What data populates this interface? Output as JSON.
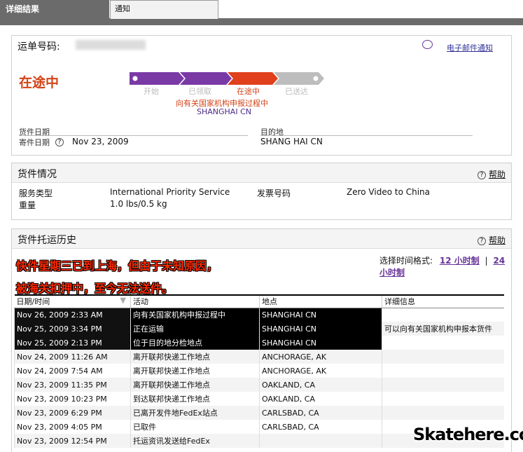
{
  "tabs": {
    "active": "详细结果",
    "inactive": "通知"
  },
  "shipment": {
    "tracking_label": "运单号码:",
    "email_label": "电子邮件通知",
    "status": "在途中",
    "progress": {
      "steps": [
        "开始",
        "已领取",
        "在途中",
        "已送达"
      ],
      "current_index": 2,
      "message": "向有关国家机构申报过程中",
      "location": "SHANGHAI CN",
      "colors": {
        "done": "#7a3aa6",
        "current": "#e0401c",
        "pending": "#bdbdbd"
      }
    },
    "ship_date_group_label": "货件日期",
    "ship_date_label": "寄件日期",
    "ship_date": "Nov 23, 2009",
    "destination_label": "目的地",
    "destination": "SHANG HAI CN"
  },
  "details": {
    "title": "货件情况",
    "help": "帮助",
    "service_type_label": "服务类型",
    "service_type": "International Priority Service",
    "invoice_label": "发票号码",
    "invoice": "Zero Video to China",
    "weight_label": "重量",
    "weight": "1.0 lbs/0.5 kg"
  },
  "history": {
    "title": "货件托运历史",
    "help": "帮助",
    "alert_line1": "快件星期三已到上海，但由于未知原因，",
    "alert_line2": "被海关扣押中，至今无法送件。",
    "time_format_label": "选择时间格式:",
    "format_12": "12 小时制",
    "separator": "|",
    "format_24": "24 小时制",
    "columns": [
      "日期/时间",
      "活动",
      "地点",
      "详细信息"
    ],
    "rows": [
      [
        "Nov 26, 2009 2:33 AM",
        "向有关国家机构申报过程中",
        "SHANGHAI CN",
        ""
      ],
      [
        "Nov 25, 2009 3:34 PM",
        "正在运输",
        "SHANGHAI CN",
        "可以向有关国家机构申报本货件"
      ],
      [
        "Nov 25, 2009 2:13 PM",
        "位于目的地分检地点",
        "SHANGHAI CN",
        ""
      ],
      [
        "Nov 24, 2009 11:26 AM",
        "离开联邦快递工作地点",
        "ANCHORAGE, AK",
        ""
      ],
      [
        "Nov 24, 2009 7:54 AM",
        "离开联邦快递工作地点",
        "ANCHORAGE, AK",
        ""
      ],
      [
        "Nov 23, 2009 11:35 PM",
        "离开联邦快递工作地点",
        "OAKLAND, CA",
        ""
      ],
      [
        "Nov 23, 2009 10:23 PM",
        "到达联邦快递工作地点",
        "OAKLAND, CA",
        ""
      ],
      [
        "Nov 23, 2009 6:29 PM",
        "已离开发件地FedEx站点",
        "CARLSBAD, CA",
        ""
      ],
      [
        "Nov 23, 2009 4:05 PM",
        "已取件",
        "CARLSBAD, CA",
        ""
      ],
      [
        "Nov 23, 2009 12:54 PM",
        "托运资讯发送给FedEx",
        "",
        ""
      ]
    ],
    "highlighted_rows": 3
  },
  "watermark": "Skatehere.com"
}
